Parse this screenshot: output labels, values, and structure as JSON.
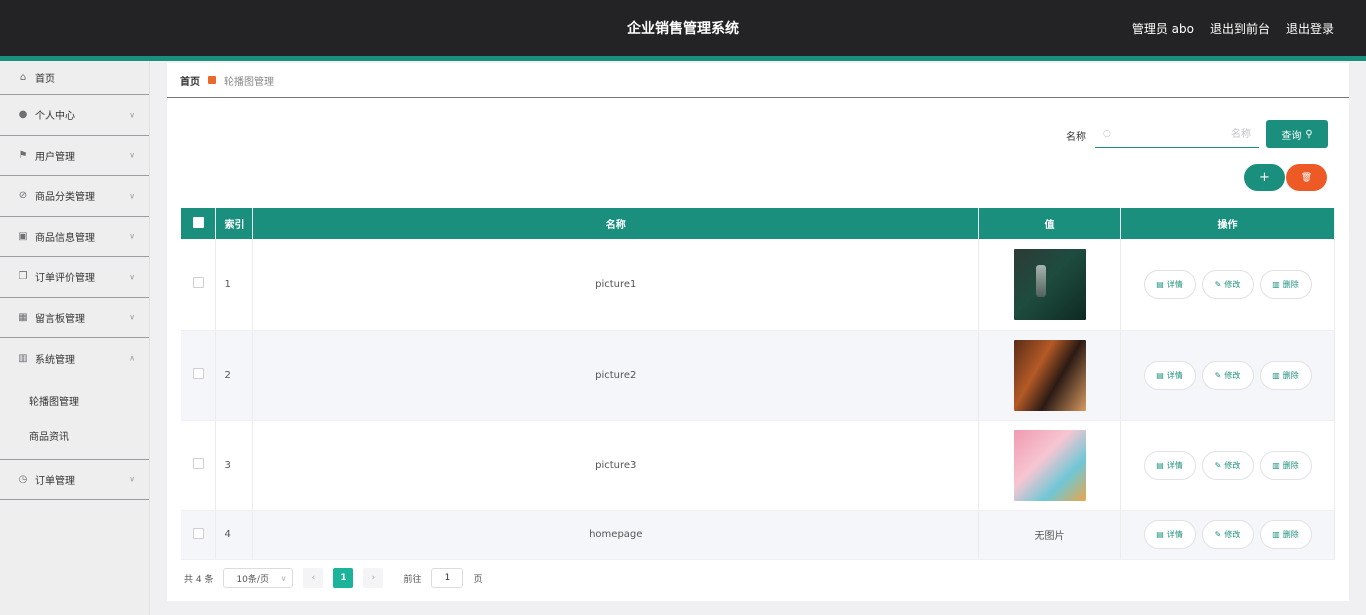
{
  "header": {
    "title": "企业销售管理系统",
    "user_label": "管理员 abo",
    "front_label": "退出到前台",
    "logout_label": "退出登录"
  },
  "sidebar": {
    "items": [
      {
        "label": "首页",
        "icon": "home-icon"
      },
      {
        "label": "个人中心",
        "icon": "user-icon"
      },
      {
        "label": "用户管理",
        "icon": "flag-icon"
      },
      {
        "label": "商品分类管理",
        "icon": "tag-icon"
      },
      {
        "label": "商品信息管理",
        "icon": "chart-icon"
      },
      {
        "label": "订单评价管理",
        "icon": "copy-icon"
      },
      {
        "label": "留言板管理",
        "icon": "grid-icon"
      },
      {
        "label": "系统管理",
        "icon": "building-icon"
      },
      {
        "label": "订单管理",
        "icon": "clock-icon"
      }
    ],
    "submenu": [
      "轮播图管理",
      "商品资讯"
    ]
  },
  "breadcrumb": {
    "home": "首页",
    "current": "轮播图管理"
  },
  "search": {
    "label": "名称",
    "placeholder": "名称",
    "button": "查询"
  },
  "table": {
    "headers": [
      "索引",
      "名称",
      "值",
      "操作"
    ],
    "rows": [
      {
        "index": "1",
        "name": "picture1",
        "value_image": "thumb1"
      },
      {
        "index": "2",
        "name": "picture2",
        "value_image": "thumb2"
      },
      {
        "index": "3",
        "name": "picture3",
        "value_image": "thumb3"
      },
      {
        "index": "4",
        "name": "homepage",
        "value_text": "无图片"
      }
    ],
    "actions": {
      "detail": "详情",
      "edit": "修改",
      "delete": "删除"
    }
  },
  "pagination": {
    "total": "共 4 条",
    "page_size": "10条/页",
    "current_page": "1",
    "goto_prefix": "前往",
    "goto_value": "1",
    "goto_suffix": "页"
  },
  "colors": {
    "accent": "#1b8f7e",
    "danger": "#ee5a26",
    "header_bg": "#232325"
  }
}
